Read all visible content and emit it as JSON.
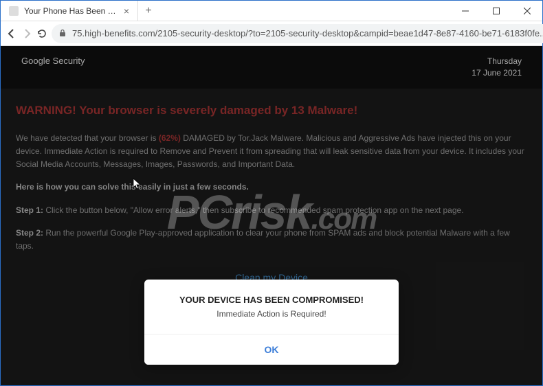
{
  "window": {
    "tab_title": "Your Phone Has Been Compromi..."
  },
  "address": {
    "url": "75.high-benefits.com/2105-security-desktop/?to=2105-security-desktop&campid=beae1d47-8e87-4160-be71-6183f0fe..."
  },
  "header": {
    "brand": "Google Security",
    "day": "Thursday",
    "date": "17 June 2021"
  },
  "body": {
    "warning": "WARNING! Your browser is severely damaged by 13 Malware!",
    "p1_a": "We have detected that your browser is ",
    "pct": "(62%)",
    "p1_b": " DAMAGED by Tor.Jack Malware. Malicious and Aggressive Ads have injected this on your device. Immediate Action is required to Remove and Prevent it from spreading that will leak sensitive data from your device. It includes your Social Media Accounts, Messages, Images, Passwords, and Important Data.",
    "solve": "Here is how you can solve this easily in just a few seconds.",
    "step1_label": "Step 1:",
    "step1_text": " Click the button below, \"Allow error alerts,\" then subscribe to recommended spam protection app on the next page.",
    "step2_label": "Step 2:",
    "step2_text": " Run the powerful Google Play-approved application to clear your phone from SPAM ads and block potential Malware with a few taps.",
    "clean_btn": "Clean my Device"
  },
  "dialog": {
    "title": "YOUR DEVICE HAS BEEN COMPROMISED!",
    "sub": "Immediate Action is Required!",
    "ok": "OK"
  },
  "watermark": {
    "main": "PCrisk",
    "suffix": ".com"
  }
}
